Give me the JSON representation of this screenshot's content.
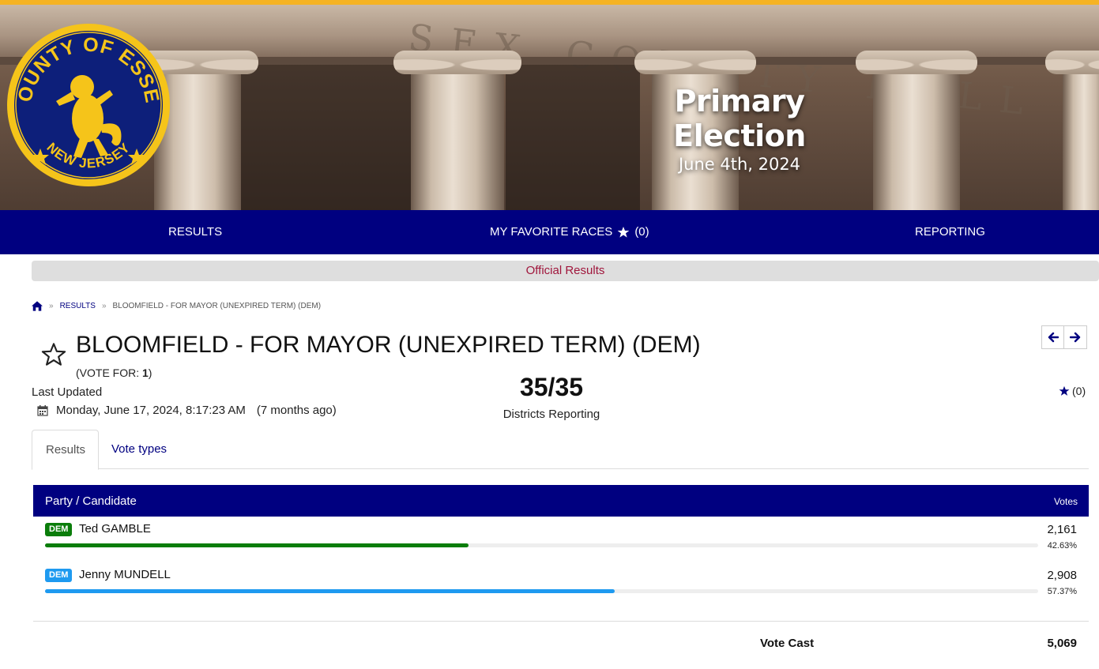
{
  "header": {
    "seal": {
      "top_text": "COUNTY OF ESSEX",
      "bottom_text": "NEW JERSEY"
    },
    "building_inscription": "SEX COUNTY HALL OF RE",
    "election_title": "Primary Election",
    "election_date": "June 4th, 2024"
  },
  "nav": {
    "results_label": "RESULTS",
    "favorites_label": "MY FAVORITE RACES",
    "favorites_count": "(0)",
    "reporting_label": "REPORTING"
  },
  "status_banner": "Official Results",
  "breadcrumb": {
    "level1": "RESULTS",
    "level2": "BLOOMFIELD - FOR MAYOR (UNEXPIRED TERM) (DEM)"
  },
  "race": {
    "title": "BLOOMFIELD - FOR MAYOR (UNEXPIRED TERM) (DEM)",
    "vote_for_prefix": "(VOTE FOR: ",
    "vote_for_count": "1",
    "vote_for_suffix": ")",
    "last_updated_label": "Last Updated",
    "last_updated_value": "Monday, June 17, 2024, 8:17:23 AM",
    "last_updated_ago": "(7 months ago)",
    "districts_reporting": "35/35",
    "districts_label": "Districts Reporting",
    "favorite_count": "(0)"
  },
  "tabs": [
    {
      "label": "Results",
      "active": true
    },
    {
      "label": "Vote types",
      "active": false
    }
  ],
  "table": {
    "col_candidate": "Party / Candidate",
    "col_votes": "Votes",
    "candidates": [
      {
        "party": "DEM",
        "name": "Ted GAMBLE",
        "votes": "2,161",
        "percent": "42.63%",
        "share": 0.4263,
        "color": "#0a7d0a"
      },
      {
        "party": "DEM",
        "name": "Jenny MUNDELL",
        "votes": "2,908",
        "percent": "57.37%",
        "share": 0.5737,
        "color": "#1e9af0"
      }
    ],
    "vote_cast_label": "Vote Cast",
    "vote_cast_total": "5,069"
  },
  "colors": {
    "nav_bg": "#000080",
    "accent_gold": "#f5b324",
    "official_text": "#a0163c"
  }
}
